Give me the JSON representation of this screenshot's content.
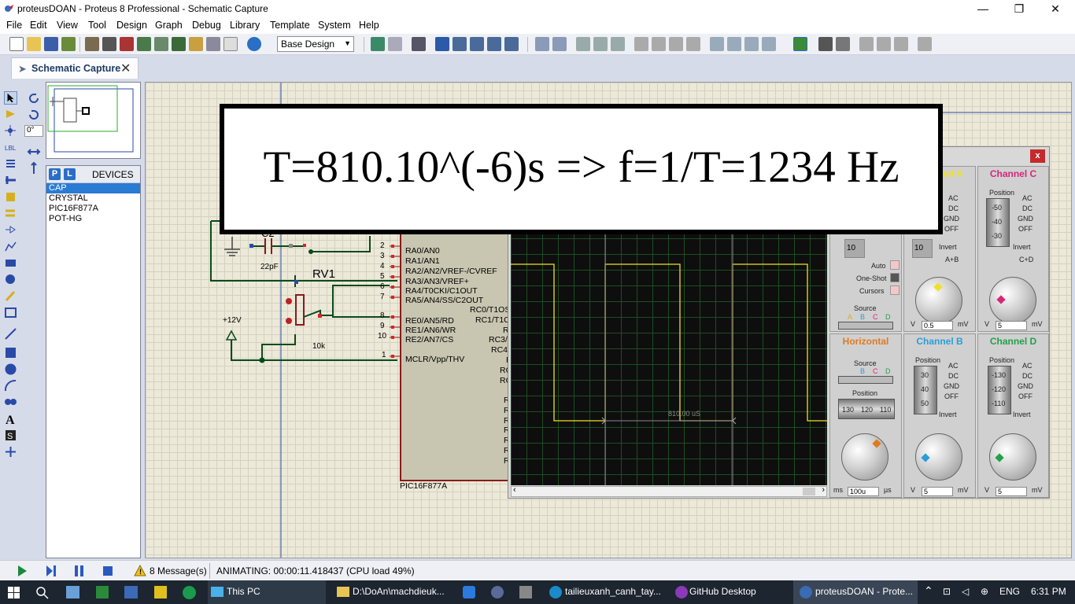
{
  "window": {
    "title": "proteusDOAN - Proteus 8 Professional - Schematic Capture",
    "minimize": "—",
    "restore": "❐",
    "close": "✕"
  },
  "menu": [
    "File",
    "Edit",
    "View",
    "Tool",
    "Design",
    "Graph",
    "Debug",
    "Library",
    "Template",
    "System",
    "Help"
  ],
  "toolbar": {
    "design_select": "Base Design"
  },
  "tabs": [
    {
      "label": "Schematic Capture",
      "close": "✕"
    }
  ],
  "devices": {
    "p_label": "P",
    "l_label": "L",
    "title": "DEVICES",
    "items": [
      "CAP",
      "CRYSTAL",
      "PIC16F877A",
      "POT-HG"
    ],
    "selected": "CAP"
  },
  "rotation": "0°",
  "schematic": {
    "cap_ref": "C2",
    "cap_value": "22pF",
    "pot_ref": "RV1",
    "pot_value": "10k",
    "supply_label": "+12V",
    "mcu_name": "PIC16F877A",
    "pins_left": [
      {
        "num": "2",
        "name": "RA0/AN0"
      },
      {
        "num": "3",
        "name": "RA1/AN1"
      },
      {
        "num": "4",
        "name": "RA2/AN2/VREF-/CVREF"
      },
      {
        "num": "5",
        "name": "RA3/AN3/VREF+"
      },
      {
        "num": "6",
        "name": "RA4/T0CKI/C1OUT"
      },
      {
        "num": "7",
        "name": "RA5/AN4/SS/C2OUT"
      },
      {
        "num": "8",
        "name": "RE0/AN5/RD"
      },
      {
        "num": "9",
        "name": "RE1/AN6/WR"
      },
      {
        "num": "10",
        "name": "RE2/AN7/CS"
      },
      {
        "num": "1",
        "name": "MCLR/Vpp/THV"
      }
    ],
    "pins_right": [
      "RC0/T1OS",
      "RC1/T1C",
      "R",
      "RC3/",
      "RC4",
      "R",
      "RC",
      "RC",
      "R",
      "R",
      "R",
      "R",
      "R",
      "R",
      "R"
    ]
  },
  "oscilloscope": {
    "close": "x",
    "measurement": "810.00 uS",
    "channel_a_title": "Channel A",
    "channel_b_title": "Channel B",
    "channel_c_title": "Channel C",
    "channel_d_title": "Channel D",
    "horizontal_title": "Horizontal",
    "trigger_value": "10",
    "ch_a_value": "0.5",
    "ch_a_unit_l": "V",
    "ch_a_unit_r": "mV",
    "ch_b_value": "5",
    "ch_c_value": "5",
    "ch_d_value": "5",
    "timebase_value": "100u",
    "timebase_unit_l": "ms",
    "timebase_unit_r": "µs",
    "coupling": [
      "AC",
      "DC",
      "GND",
      "OFF"
    ],
    "invert": "Invert",
    "ab_label": "A+B",
    "cd_label": "C+D",
    "position": "Position",
    "source": "Source",
    "sources": [
      "A",
      "B",
      "C",
      "D"
    ],
    "trigger_modes": [
      "Auto",
      "One-Shot",
      "Cursors"
    ],
    "pos_c": [
      "-50",
      "-40",
      "-30"
    ],
    "pos_b": [
      "30",
      "40",
      "50"
    ],
    "pos_d": [
      "-130",
      "-120",
      "-110"
    ],
    "pos_h": [
      "130",
      "120",
      "110"
    ],
    "colors": {
      "a": "#f0e02a",
      "b": "#2a9ed8",
      "c": "#d8267a",
      "d": "#22a04a",
      "horizontal": "#e07a20"
    }
  },
  "banner": {
    "text": "T=810.10^(-6)s => f=1/T=1234 Hz"
  },
  "status": {
    "messages": "8 Message(s)",
    "animation": "ANIMATING: 00:00:11.418437 (CPU load 49%)"
  },
  "taskbar": {
    "items": [
      "This PC",
      "D:\\DoAn\\machdieuk...",
      "tailieuxanh_canh_tay...",
      "GitHub Desktop",
      "proteusDOAN - Prote..."
    ],
    "language": "ENG",
    "time": "6:31 PM"
  }
}
